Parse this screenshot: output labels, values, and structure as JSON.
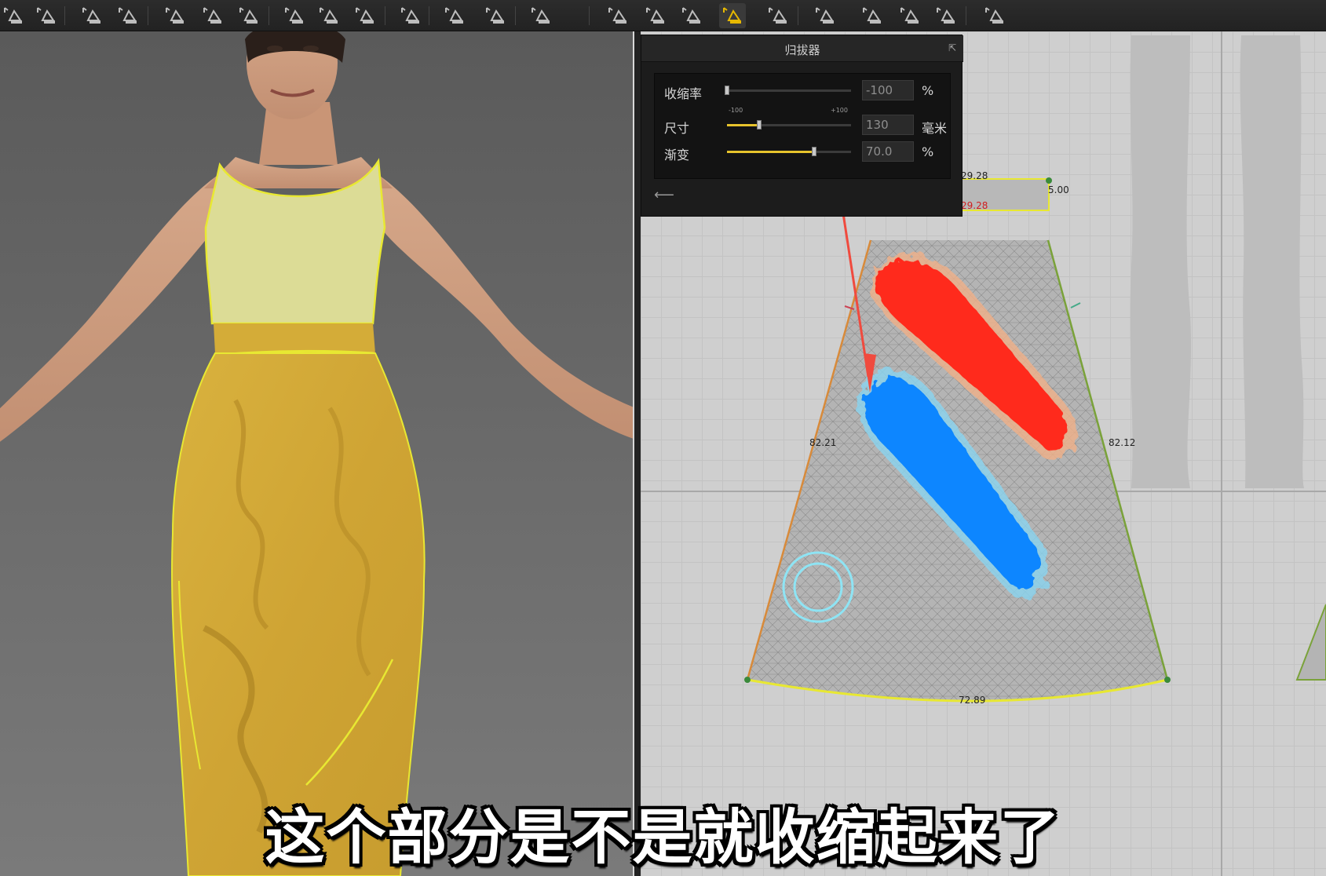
{
  "toolbar": {
    "tools": [
      {
        "icon": "select-sewing-icon",
        "active": false
      },
      {
        "icon": "edit-sewing-icon",
        "active": false
      },
      {
        "icon": "segment-sewing-icon",
        "active": false
      },
      {
        "icon": "free-sewing-icon",
        "active": false
      },
      {
        "icon": "pin-icon",
        "active": false
      },
      {
        "icon": "fold-arrangement-icon",
        "active": false
      },
      {
        "icon": "fold-icon",
        "active": false
      },
      {
        "icon": "button-icon",
        "active": false
      },
      {
        "icon": "buttonhole-icon",
        "active": false
      },
      {
        "icon": "zipper-icon",
        "active": false
      },
      {
        "icon": "select-piece-icon",
        "active": false
      },
      {
        "icon": "flat-piece-icon",
        "active": false
      },
      {
        "icon": "arrangement-icon",
        "active": false
      },
      {
        "icon": "tape-icon",
        "active": false
      },
      {
        "icon": "edit-tape-icon",
        "active": false
      },
      {
        "icon": "gathering-icon",
        "active": false
      },
      {
        "icon": "trim-icon",
        "active": false
      },
      {
        "icon": "iron-shrink-icon",
        "active": true
      },
      {
        "icon": "avatar-select-icon",
        "active": false
      },
      {
        "icon": "avatar-edit-icon",
        "active": false
      },
      {
        "icon": "avatar-fit-icon",
        "active": false
      },
      {
        "icon": "measure-icon",
        "active": false
      },
      {
        "icon": "tape-measure-icon",
        "active": false
      },
      {
        "icon": "topstitch-icon",
        "active": false
      }
    ]
  },
  "panel": {
    "title": "归拔器",
    "rows": [
      {
        "label": "收缩率",
        "value": "-100",
        "unit": "%",
        "fill": 0.0,
        "min_label": "-100",
        "max_label": "+100"
      },
      {
        "label": "尺寸",
        "value": "130",
        "unit": "毫米",
        "fill": 0.26
      },
      {
        "label": "渐变",
        "value": "70.0",
        "unit": "%",
        "fill": 0.7
      }
    ]
  },
  "pattern": {
    "labels": {
      "top": "29.28",
      "top_red": "29.28",
      "corner": "5.00",
      "left": "82.21",
      "right": "82.12",
      "bottom": "72.89"
    },
    "colors": {
      "shrink": "#ff2a1e",
      "stretch": "#0a86ff",
      "annotation_arrow": "#f04a3e",
      "seam": "#e8e832"
    }
  },
  "subtitle": "这个部分是不是就收缩起来了"
}
